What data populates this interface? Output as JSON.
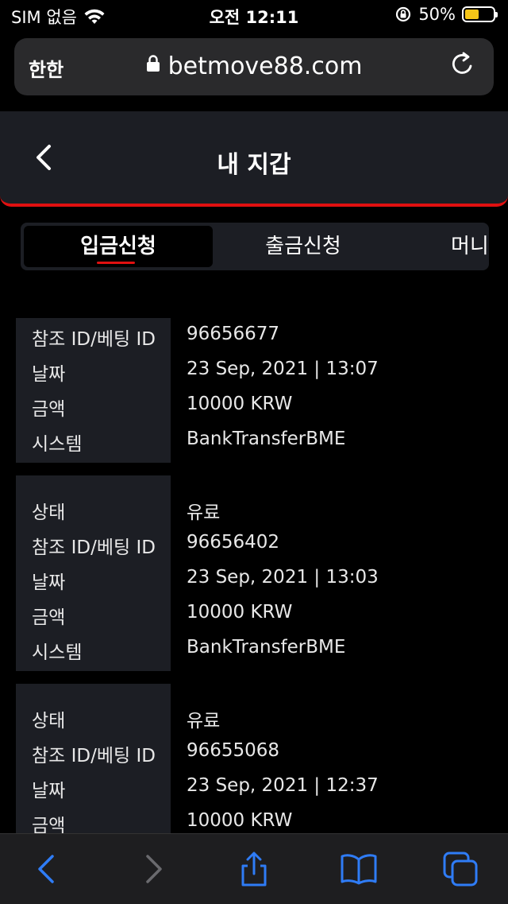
{
  "status_bar": {
    "carrier": "SIM 없음",
    "time": "오전 12:11",
    "battery_percent": "50%",
    "battery_level": 0.5
  },
  "browser": {
    "aa_label": "한한",
    "url": "betmove88.com"
  },
  "header": {
    "title": "내 지갑"
  },
  "tabs": [
    {
      "label": "입금신청",
      "active": true
    },
    {
      "label": "출금신청",
      "active": false
    },
    {
      "label": "머니",
      "active": false
    }
  ],
  "records": [
    {
      "rows": [
        {
          "label": "참조 ID/베팅 ID",
          "value": "96656677"
        },
        {
          "label": "날짜",
          "value": "23 Sep, 2021 | 13:07"
        },
        {
          "label": "금액",
          "value": "10000 KRW"
        },
        {
          "label": "시스템",
          "value": "BankTransferBME"
        }
      ]
    },
    {
      "rows": [
        {
          "label": "상태",
          "value": "유료"
        },
        {
          "label": "참조 ID/베팅 ID",
          "value": "96656402"
        },
        {
          "label": "날짜",
          "value": "23 Sep, 2021 | 13:03"
        },
        {
          "label": "금액",
          "value": "10000 KRW"
        },
        {
          "label": "시스템",
          "value": "BankTransferBME"
        }
      ]
    },
    {
      "rows": [
        {
          "label": "상태",
          "value": "유료"
        },
        {
          "label": "참조 ID/베팅 ID",
          "value": "96655068"
        },
        {
          "label": "날짜",
          "value": "23 Sep, 2021 | 12:37"
        },
        {
          "label": "금액",
          "value": "10000 KRW"
        }
      ]
    }
  ],
  "colors": {
    "accent": "#e01010",
    "panel": "#1c1e24",
    "ios_blue": "#2f7cf6",
    "battery": "#f5c518"
  },
  "icons": {
    "wifi": "wifi-icon",
    "orientation_lock": "orientation-lock-icon",
    "lock": "lock-icon",
    "reload": "reload-icon",
    "back": "chevron-left-icon",
    "nav_back": "nav-back-icon",
    "nav_forward": "nav-forward-icon",
    "share": "share-icon",
    "bookmarks": "bookmarks-icon",
    "tabs": "tabs-icon"
  }
}
